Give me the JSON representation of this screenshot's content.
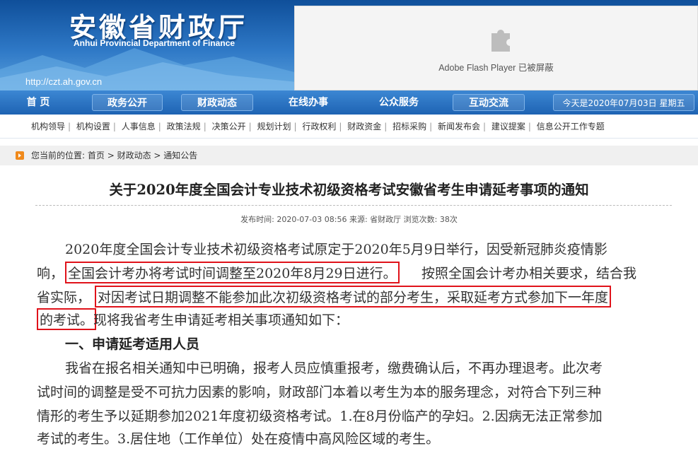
{
  "header": {
    "title": "安徽省财政厅",
    "subtitle_en": "Anhui Provincial Department of Finance",
    "url": "http://czt.ah.gov.cn",
    "flash_notice": "Adobe Flash Player 已被屏蔽"
  },
  "nav": {
    "items": [
      "首 页",
      "政务公开",
      "财政动态",
      "在线办事",
      "公众服务",
      "互动交流"
    ],
    "date": "今天是2020年07月03日 星期五"
  },
  "subnav": {
    "items": [
      "机构领导",
      "机构设置",
      "人事信息",
      "政策法规",
      "决策公开",
      "规划计划",
      "行政权利",
      "财政资金",
      "招标采购",
      "新闻发布会",
      "建议提案",
      "信息公开工作专题"
    ]
  },
  "breadcrumb": {
    "label": "您当前的位置:",
    "items": [
      "首页",
      "财政动态",
      "通知公告"
    ]
  },
  "article": {
    "title": "关于2020年度全国会计专业技术初级资格考试安徽省考生申请延考事项的通知",
    "meta": "发布时间: 2020-07-03 08:56  来源: 省财政厅  浏览次数: 38次",
    "lines": [
      "2020年度全国会计专业技术初级资格考试原定于2020年5月9日举行，因受新冠肺炎疫情影",
      "响，",
      "全国会计考办将考试时间调整至2020年8月29日进行。",
      "按照全国会计考办相关要求，结合我",
      "省实际，",
      "对因考试日期调整不能参加此次初级资格考试的部分考生，采取延考方式参加下一年度",
      "的考试。",
      "现将我省考生申请延考相关事项通知如下：",
      "一、申请延考适用人员",
      "我省在报名相关通知中已明确，报考人员应慎重报考，缴费确认后，不再办理退考。此次考",
      "试时间的调整是受不可抗力因素的影响，财政部门本着以考生为本的服务理念，对符合下列三种",
      "情形的考生予以延期参加2021年度初级资格考试。1.在8月份临产的孕妇。2.因病无法正常参加",
      "考试的考生。3.居住地（工作单位）处在疫情中高风险区域的考生。"
    ]
  },
  "colors": {
    "header_blue": "#1e63b3",
    "highlight_red": "#e0121a"
  }
}
